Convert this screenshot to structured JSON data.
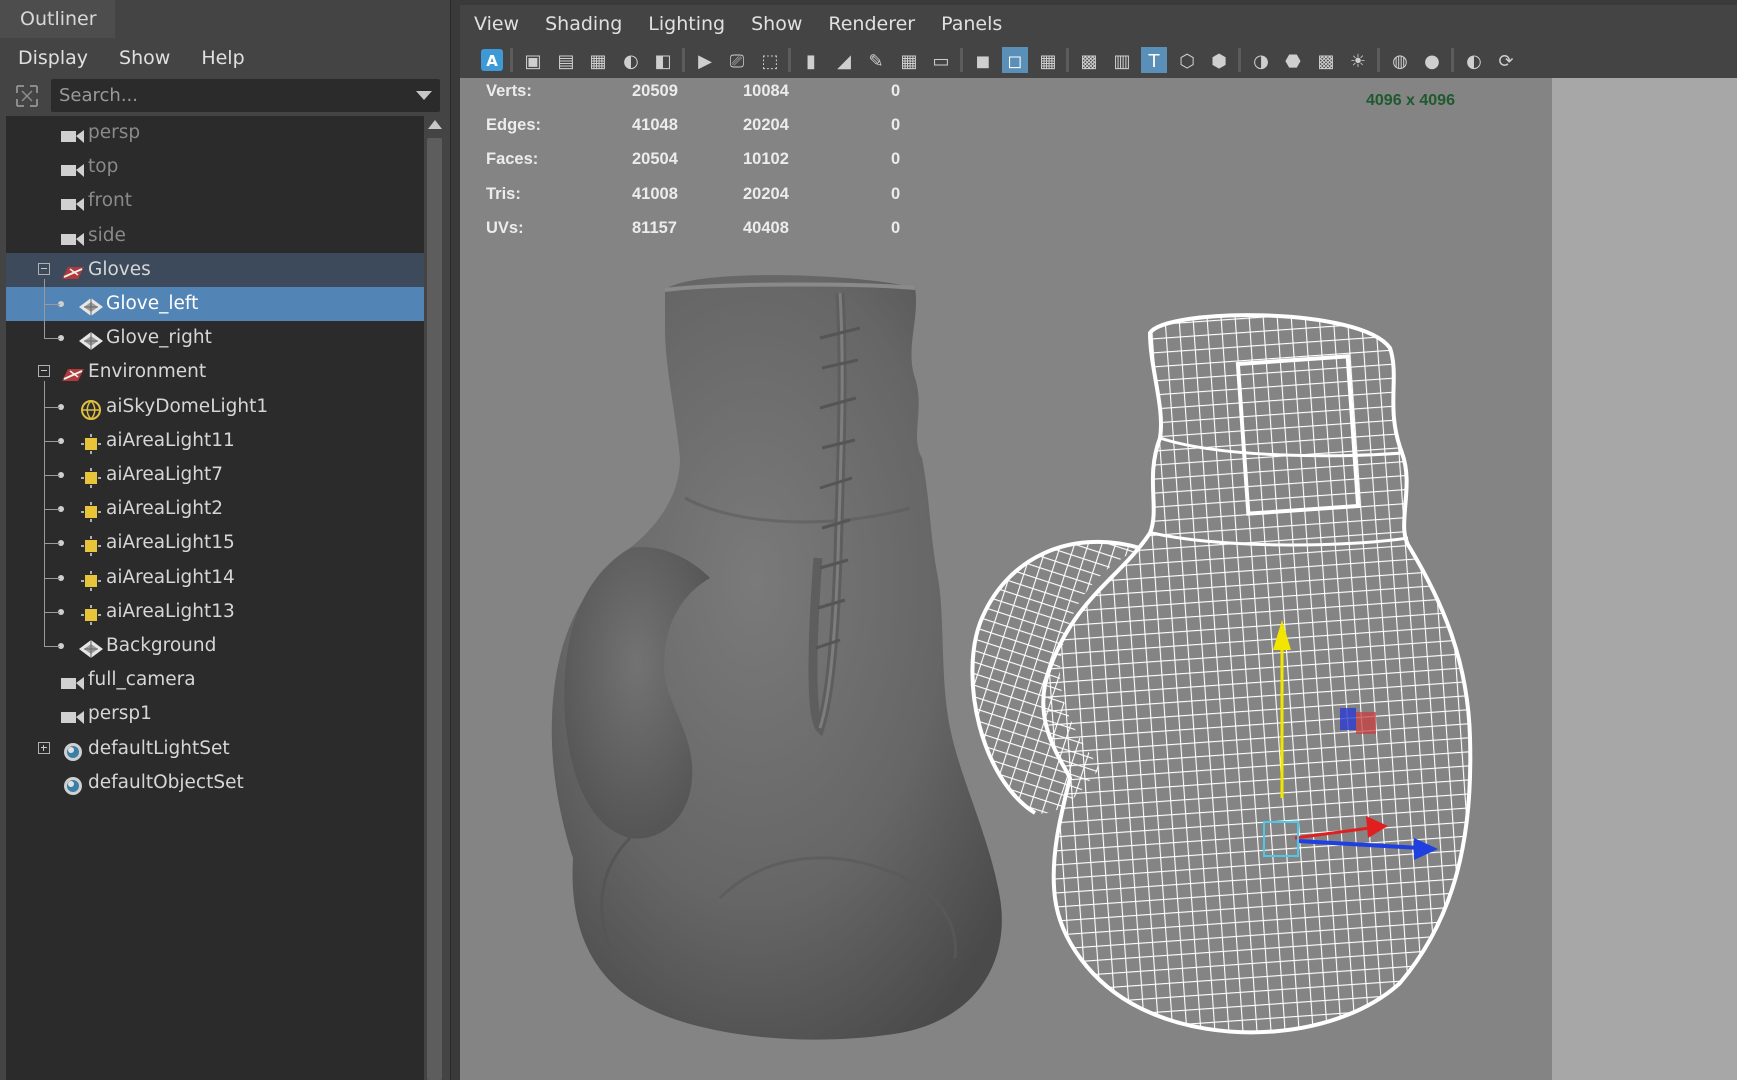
{
  "outliner": {
    "title": "Outliner",
    "menu": [
      "Display",
      "Show",
      "Help"
    ],
    "search_placeholder": "Search...",
    "items": [
      {
        "label": "persp",
        "icon": "camera-icon",
        "depth": 0,
        "dim": true
      },
      {
        "label": "top",
        "icon": "camera-icon",
        "depth": 0,
        "dim": true
      },
      {
        "label": "front",
        "icon": "camera-icon",
        "depth": 0,
        "dim": true
      },
      {
        "label": "side",
        "icon": "camera-icon",
        "depth": 0,
        "dim": true
      },
      {
        "label": "Gloves",
        "icon": "group-icon",
        "depth": 0,
        "expander": "minus",
        "state": "parent-of-selected"
      },
      {
        "label": "Glove_left",
        "icon": "mesh-icon",
        "depth": 1,
        "state": "selected"
      },
      {
        "label": "Glove_right",
        "icon": "mesh-icon",
        "depth": 1
      },
      {
        "label": "Environment",
        "icon": "group-icon",
        "depth": 0,
        "expander": "minus"
      },
      {
        "label": "aiSkyDomeLight1",
        "icon": "skydome-light-icon",
        "depth": 1
      },
      {
        "label": "aiAreaLight11",
        "icon": "area-light-icon",
        "depth": 1
      },
      {
        "label": "aiAreaLight7",
        "icon": "area-light-icon",
        "depth": 1
      },
      {
        "label": "aiAreaLight2",
        "icon": "area-light-icon",
        "depth": 1
      },
      {
        "label": "aiAreaLight15",
        "icon": "area-light-icon",
        "depth": 1
      },
      {
        "label": "aiAreaLight14",
        "icon": "area-light-icon",
        "depth": 1
      },
      {
        "label": "aiAreaLight13",
        "icon": "area-light-icon",
        "depth": 1
      },
      {
        "label": "Background",
        "icon": "mesh-icon",
        "depth": 1
      },
      {
        "label": "full_camera",
        "icon": "camera-icon",
        "depth": 0
      },
      {
        "label": "persp1",
        "icon": "camera-icon",
        "depth": 0
      },
      {
        "label": "defaultLightSet",
        "icon": "set-icon",
        "depth": 0,
        "expander": "plus"
      },
      {
        "label": "defaultObjectSet",
        "icon": "set-icon",
        "depth": 0
      }
    ]
  },
  "viewport": {
    "menu": [
      "View",
      "Shading",
      "Lighting",
      "Show",
      "Renderer",
      "Panels"
    ],
    "toolbar_icons": [
      "select-camera-icon",
      "camera-attributes-icon",
      "bookmark-icon",
      "image-plane-icon",
      "2d-pan-zoom-icon",
      "grease-pencil-icon",
      "grid-icon",
      "film-gate-icon",
      "resolution-gate-icon",
      "gate-mask-icon",
      "field-chart-icon",
      "safe-action-icon",
      "safe-title-icon",
      "wireframe-icon",
      "smooth-shade-icon",
      "use-default-material-icon",
      "wireframe-on-shaded-icon",
      "xray-icon",
      "textured-icon",
      "use-all-lights-icon",
      "shadows-icon",
      "screen-space-ao-icon",
      "motion-blur-icon",
      "anti-aliasing-icon",
      "depth-of-field-icon",
      "isolate-select-icon",
      "xray-joints-icon",
      "xray-active-icon",
      "camera-lock-icon"
    ],
    "hud": {
      "rows": [
        {
          "label": "Verts:",
          "values": [
            "20509",
            "10084",
            "0"
          ]
        },
        {
          "label": "Edges:",
          "values": [
            "41048",
            "20204",
            "0"
          ]
        },
        {
          "label": "Faces:",
          "values": [
            "20504",
            "10102",
            "0"
          ]
        },
        {
          "label": "Tris:",
          "values": [
            "41008",
            "20204",
            "0"
          ]
        },
        {
          "label": "UVs:",
          "values": [
            "81157",
            "40408",
            "0"
          ]
        }
      ]
    },
    "resolution": "4096 x 4096",
    "colors": {
      "selection": "#5285b6",
      "wireframe": "#ffffff",
      "resolution_text": "#1e5a2e"
    }
  }
}
